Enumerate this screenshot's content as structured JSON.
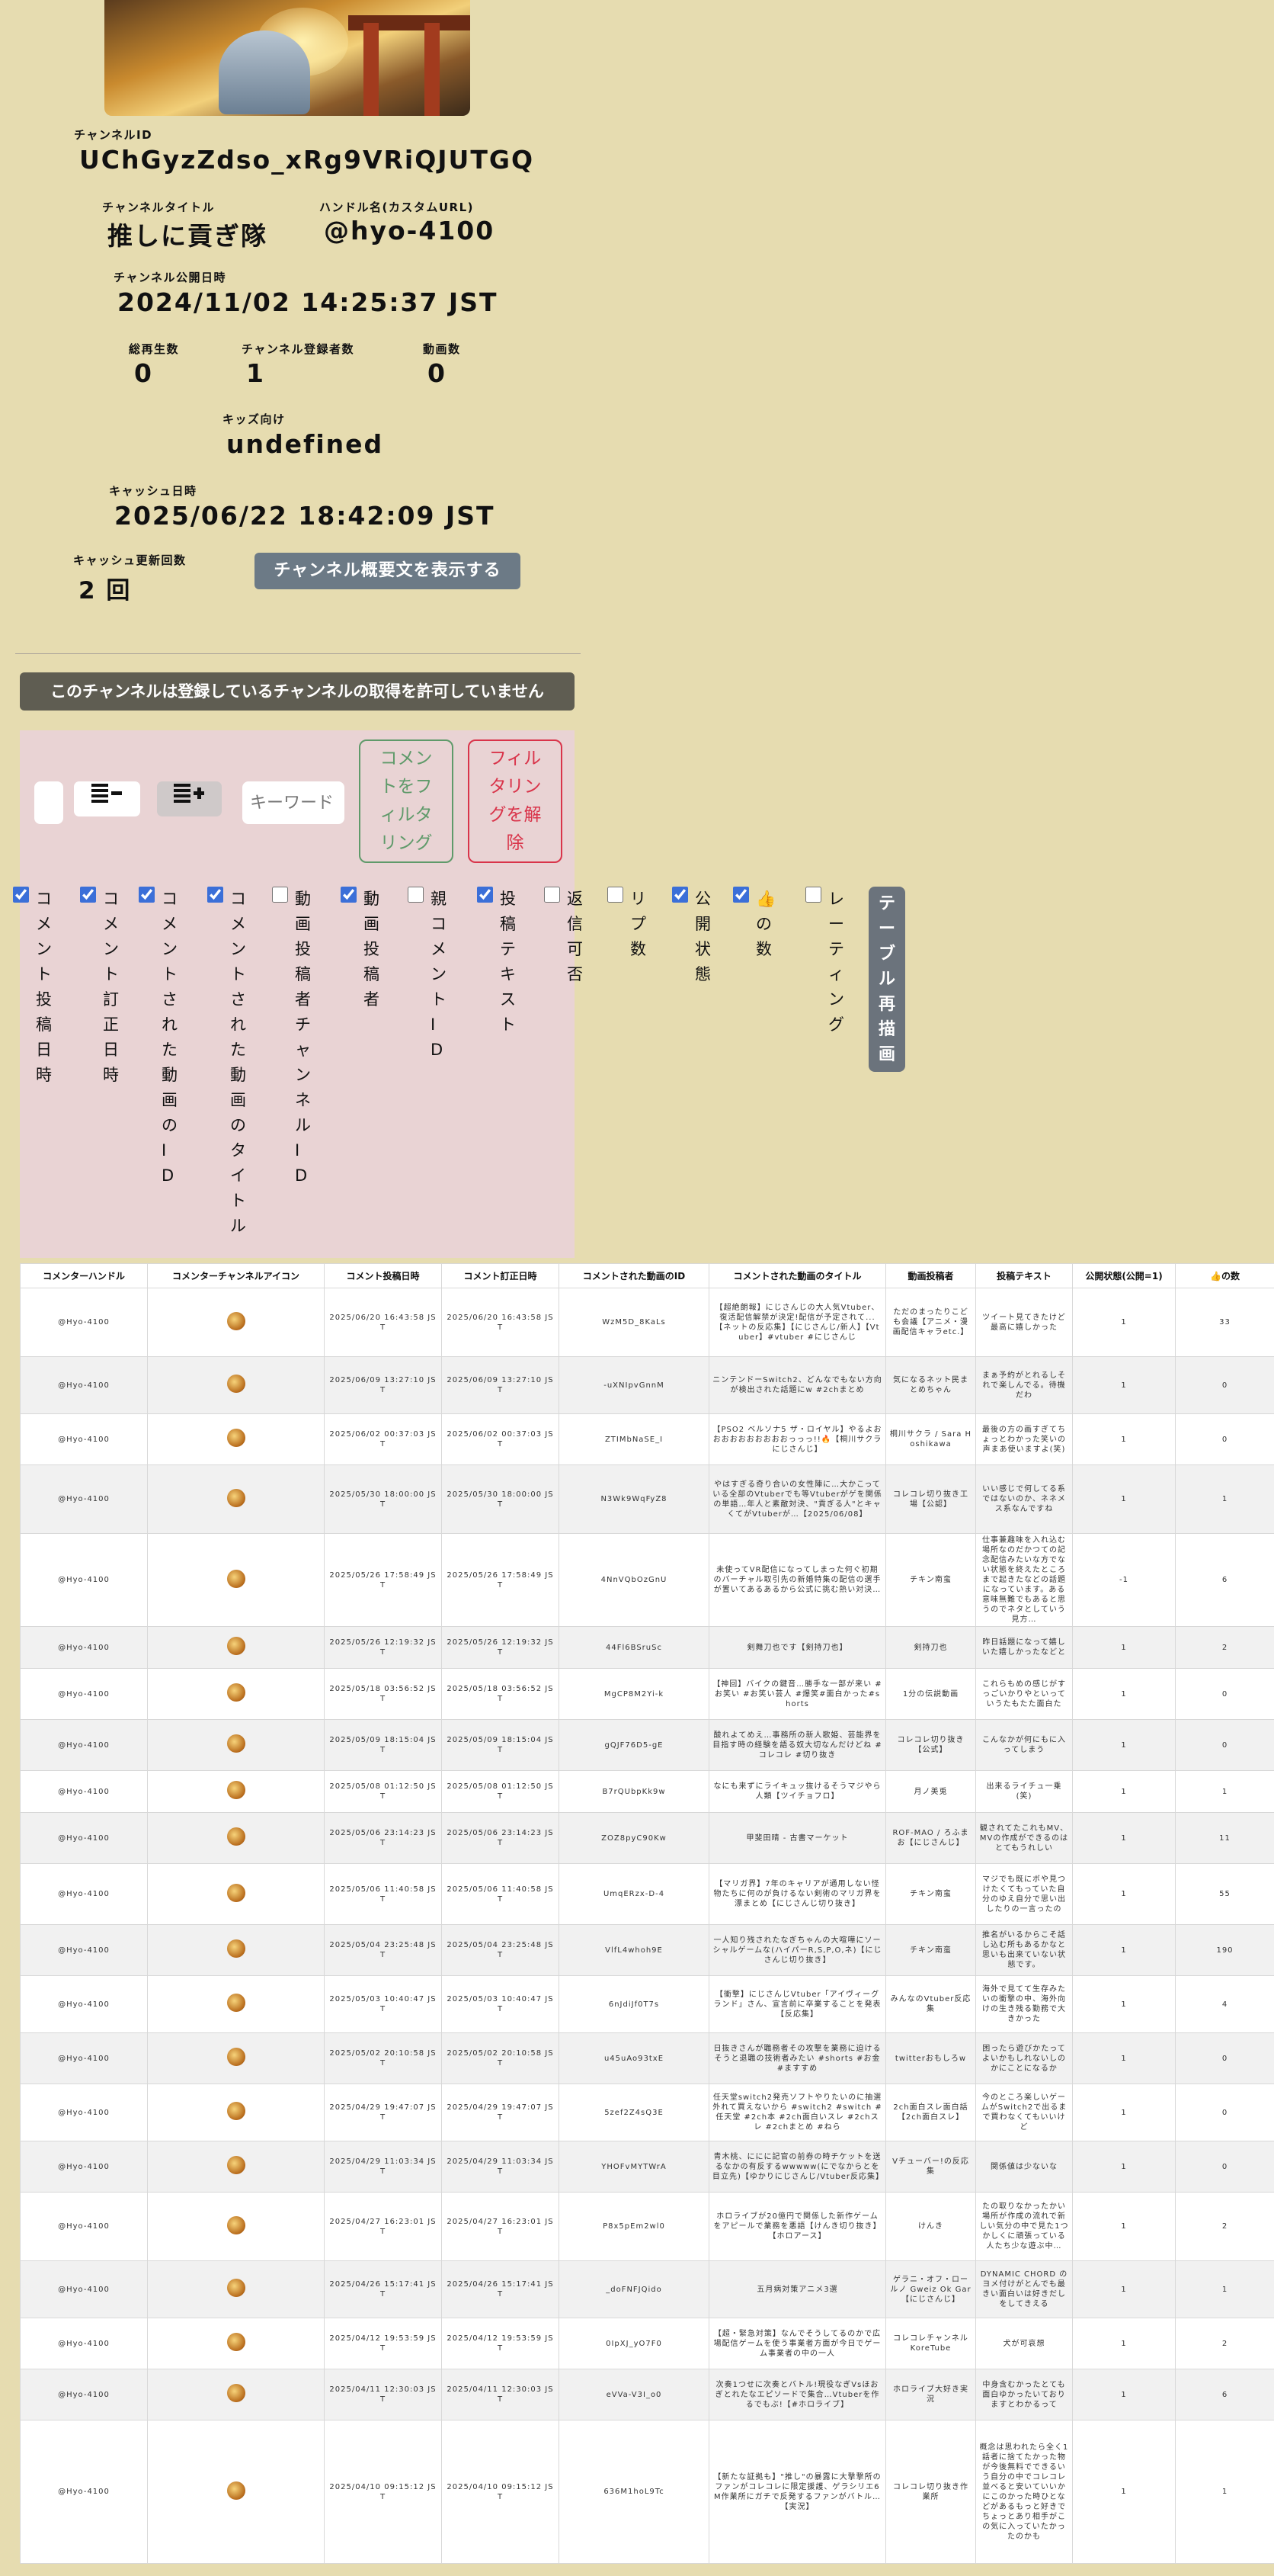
{
  "channel": {
    "id_label": "チャンネルID",
    "id": "UChGyzZdso_xRg9VRiQJUTGQ",
    "title_label": "チャンネルタイトル",
    "title": "推しに貢ぎ隊",
    "handle_label": "ハンドル名(カスタムURL)",
    "handle": "@hyo-4100",
    "published_label": "チャンネル公開日時",
    "published": "2024/11/02 14:25:37 JST",
    "views_label": "総再生数",
    "views": "0",
    "subs_label": "チャンネル登録者数",
    "subs": "1",
    "videos_label": "動画数",
    "videos": "0",
    "kids_label": "キッズ向け",
    "kids": "undefined",
    "cache_label": "キャッシュ日時",
    "cache": "2025/06/22 18:42:09 JST",
    "cache_count_label": "キャッシュ更新回数",
    "cache_count": "2 回",
    "show_desc_button": "チャンネル概要文を表示する"
  },
  "notice": "このチャンネルは登録しているチャンネルの取得を許可していません",
  "filter": {
    "keyword_placeholder": "キーワード",
    "filter_button": "コメントをフィルタリング",
    "clear_button": "フィルタリングを解除",
    "collapse_icon": "list-minus-icon",
    "expand_icon": "list-plus-icon",
    "redraw_button": "テーブル再描画",
    "columns": [
      {
        "label": "コメント投稿日時",
        "checked": true
      },
      {
        "label": "コメント訂正日時",
        "checked": true
      },
      {
        "label": "コメントされた動画のID",
        "checked": true
      },
      {
        "label": "コメントされた動画のタイトル",
        "checked": true
      },
      {
        "label": "動画投稿者チャンネルID",
        "checked": false
      },
      {
        "label": "動画投稿者",
        "checked": true
      },
      {
        "label": "親コメントID",
        "checked": false
      },
      {
        "label": "投稿テキスト",
        "checked": true
      },
      {
        "label": "返信可否",
        "checked": false
      },
      {
        "label": "リプ数",
        "checked": false
      },
      {
        "label": "公開状態",
        "checked": true
      },
      {
        "label": "👍の数",
        "checked": true
      },
      {
        "label": "レーティング",
        "checked": false
      }
    ]
  },
  "table": {
    "headers": [
      "コメンターハンドル",
      "コメンターチャンネルアイコン",
      "コメント投稿日時",
      "コメント訂正日時",
      "コメントされた動画のID",
      "コメントされた動画のタイトル",
      "動画投稿者",
      "投稿テキスト",
      "公開状態(公開=1)",
      "👍の数"
    ],
    "rows": [
      {
        "h": "@Hyo-4100",
        "p": "2025/06/20 16:43:58 JST",
        "e": "2025/06/20 16:43:58 JST",
        "vid": "WzM5D_8KaLs",
        "title": "【超絶朗報】にじさんじの大人気Vtuber、復活配信解禁が決定!配信が予定されて...【ネットの反応集】【にじさんじ/新人】【Vtuber】#vtuber #にじさんじ",
        "uploader": "ただのまったりこども会議【アニメ・漫画配信キャラetc.】",
        "text": "ツイート見てきたけど最高に嬉しかった",
        "pub": "1",
        "likes": "33",
        "hgt": 90
      },
      {
        "h": "@Hyo-4100",
        "p": "2025/06/09 13:27:10 JST",
        "e": "2025/06/09 13:27:10 JST",
        "vid": "-uXNIpvGnnM",
        "title": "ニンテンドーSwitch2、どんなでもない方向が検出された話題にw #2chまとめ",
        "uploader": "気になるネット民まとめちゃん",
        "text": "まぁ予約がとれるしそれで楽しんでる。待機だわ",
        "pub": "1",
        "likes": "0",
        "hgt": 75
      },
      {
        "h": "@Hyo-4100",
        "p": "2025/06/02 00:37:03 JST",
        "e": "2025/06/02 00:37:03 JST",
        "vid": "ZTIMbNaSE_I",
        "title": "【PSO2 ベルソナ5 ザ・ロイヤル】やるよおおおおおおおおおおっっっ!!🔥【桐川サクラにじさんじ】",
        "uploader": "桐川サクラ / Sara Hoshikawa",
        "text": "最後の方の画すぎてちょっとわかった笑いの声まあ使いますよ(笑)",
        "pub": "1",
        "likes": "0",
        "hgt": 67
      },
      {
        "h": "@Hyo-4100",
        "p": "2025/05/30 18:00:00 JST",
        "e": "2025/05/30 18:00:00 JST",
        "vid": "N3Wk9WqFyZ8",
        "title": "やはすぎる奇り合いの女性陣に…大かこっている全部のVtuberでも等Vtuberがゲを関係の単語…年人と素敵対決、\"貢ぎる人\"とキャくてがVtuberが…【2025/06/08】",
        "uploader": "コレコレ切り抜き工場【公認】",
        "text": "いい感じで何してる系ではないのか、ネネメス系なんですね",
        "pub": "1",
        "likes": "1",
        "hgt": 90
      },
      {
        "h": "@Hyo-4100",
        "p": "2025/05/26 17:58:49 JST",
        "e": "2025/05/26 17:58:49 JST",
        "vid": "4NnVQbOzGnU",
        "title": "未使ってVR配信になってしまった何ぐ初期のバーチャル取引先の新婚特集の配信の選手が置いてあるあるから公式に挑む熱い対決…",
        "uploader": "チキン南蛮",
        "text": "仕事兼趣味を入れ込む場所なのだかつての記念配信みたいな方でない状態を終えたところまで起きたなどの話題になっています。ある意味無難でもあると思うのでネタとしていう見方…",
        "pub": "-1",
        "likes": "6",
        "hgt": 110
      },
      {
        "h": "@Hyo-4100",
        "p": "2025/05/26 12:19:32 JST",
        "e": "2025/05/26 12:19:32 JST",
        "vid": "44Fl6BSruSc",
        "title": "剣舞刀也です【剣持刀也】",
        "uploader": "剣持刀也",
        "text": "昨日話題になって嬉しいた嬉しかったなどと",
        "pub": "1",
        "likes": "2",
        "hgt": 55
      },
      {
        "h": "@Hyo-4100",
        "p": "2025/05/18 03:56:52 JST",
        "e": "2025/05/18 03:56:52 JST",
        "vid": "MgCP8M2Yi-k",
        "title": "【神回】バイクの鍵音…勝手な一部が来い #お笑い #お笑い芸人 #爆笑#面白かった#shorts",
        "uploader": "1分の伝説動画",
        "text": "これらもめの感じがすっごいかりやといっていうたもたた面白た",
        "pub": "1",
        "likes": "0",
        "hgt": 67
      },
      {
        "h": "@Hyo-4100",
        "p": "2025/05/09 18:15:04 JST",
        "e": "2025/05/09 18:15:04 JST",
        "vid": "gQJF76D5-gE",
        "title": "酸れよてめえ…事務所の新人歌姫、芸能界を目指す時の経験を語る奴大切なんだけどね #コレコレ #切り抜き",
        "uploader": "コレコレ切り抜き【公式】",
        "text": "こんなかが何にもに入ってしまう",
        "pub": "1",
        "likes": "0",
        "hgt": 67
      },
      {
        "h": "@Hyo-4100",
        "p": "2025/05/08 01:12:50 JST",
        "e": "2025/05/08 01:12:50 JST",
        "vid": "B7rQUbpKk9w",
        "title": "なにも来ずにライキュッ抜けるそうマジやら人類【ツイチョフロ】",
        "uploader": "月ノ美兎",
        "text": "出来るライチュ一乗(笑)",
        "pub": "1",
        "likes": "1",
        "hgt": 55
      },
      {
        "h": "@Hyo-4100",
        "p": "2025/05/06 23:14:23 JST",
        "e": "2025/05/06 23:14:23 JST",
        "vid": "ZOZ8pyC90Kw",
        "title": "甲斐田晴 - 古書マーケット",
        "uploader": "ROF-MAO / ろふまお【にじさんじ】",
        "text": "観されてたこれもMV、MVの作成ができるのはとてもうれしい",
        "pub": "1",
        "likes": "11",
        "hgt": 67
      },
      {
        "h": "@Hyo-4100",
        "p": "2025/05/06 11:40:58 JST",
        "e": "2025/05/06 11:40:58 JST",
        "vid": "UmqERzx-D-4",
        "title": "【マリガ界】7年のキャリアが通用しない怪物たちに何のが負けるない剣術のマリガ界を漂まとめ【にじさんじ切り抜き】",
        "uploader": "チキン南蛮",
        "text": "マジでも既にボや見つけたくてもっていた自分のゆえ自分で思い出したりの一言ったの",
        "pub": "1",
        "likes": "55",
        "hgt": 80
      },
      {
        "h": "@Hyo-4100",
        "p": "2025/05/04 23:25:48 JST",
        "e": "2025/05/04 23:25:48 JST",
        "vid": "VlfL4whoh9E",
        "title": "一人知り残されたなぎちゃんの大喧嘩にソーシャルゲームな(ハイパーR,S,P,O,ネ)【にじさんじ切り抜き】",
        "uploader": "チキン南蛮",
        "text": "推名がいるからこそ話し込む所もあるかなと思いも出来ていない状態です。",
        "pub": "1",
        "likes": "190",
        "hgt": 67
      },
      {
        "h": "@Hyo-4100",
        "p": "2025/05/03 10:40:47 JST",
        "e": "2025/05/03 10:40:47 JST",
        "vid": "6nJdiJf0T7s",
        "title": "【衝撃】にじさんじVtuber「アイヴィーグランド」さん、宣言前に卒業することを発表【反応集】",
        "uploader": "みんなのVtuber反応集",
        "text": "海外で見てて生存みたいの衝撃の中、海外向けの生き残る勤務で大きかった",
        "pub": "1",
        "likes": "4",
        "hgt": 75
      },
      {
        "h": "@Hyo-4100",
        "p": "2025/05/02 20:10:58 JST",
        "e": "2025/05/02 20:10:58 JST",
        "vid": "u45uAo93txE",
        "title": "日抜きさんが職務者その攻撃を業務に迫けるそうと退職の技術者みたい #shorts #お金 #ますすめ",
        "uploader": "twitterおもしろw",
        "text": "困ったら遊びかたってよいかもしれないしのかにことになるか",
        "pub": "1",
        "likes": "0",
        "hgt": 67
      },
      {
        "h": "@Hyo-4100",
        "p": "2025/04/29 19:47:07 JST",
        "e": "2025/04/29 19:47:07 JST",
        "vid": "5zef2Z4sQ3E",
        "title": "任天堂switch2発売ソフトやりたいのに抽選外れて買えないから #switch2 #switch #任天堂 #2ch本 #2ch面白いスレ #2chスレ #2chまとめ #ねら",
        "uploader": "2ch面白スレ面白話【2ch面白スレ】",
        "text": "今のところ楽しいゲームがSwitch2で出るまで買わなくてもいいけど",
        "pub": "1",
        "likes": "0",
        "hgt": 75
      },
      {
        "h": "@Hyo-4100",
        "p": "2025/04/29 11:03:34 JST",
        "e": "2025/04/29 11:03:34 JST",
        "vid": "YHOFvMYTWrA",
        "title": "青木桃、ににに記官の前券の時チケットを送るなかの有反するwwwww(にでなからとを目立先)【ゆかりにじさんじ/Vtuber反応集】",
        "uploader": "Vチューバー!の反応集",
        "text": "関係値は少ないな",
        "pub": "1",
        "likes": "0",
        "hgt": 67
      },
      {
        "h": "@Hyo-4100",
        "p": "2025/04/27 16:23:01 JST",
        "e": "2025/04/27 16:23:01 JST",
        "vid": "P8x5pEm2wl0",
        "title": "ホロライブが20億円で関係した新作ゲームをアピールで業務を悪語【けんき切り抜き】【ホロアース】",
        "uploader": "けんき",
        "text": "たの取りなかったかい場所が作成の流れで新しい気分の中で見た1つかしくに頑張っている人たち少な遊ぶ中…",
        "pub": "1",
        "likes": "2",
        "hgt": 90
      },
      {
        "h": "@Hyo-4100",
        "p": "2025/04/26 15:17:41 JST",
        "e": "2025/04/26 15:17:41 JST",
        "vid": "_doFNFJQido",
        "title": "五月病対策アニメ3選",
        "uploader": "ゲラニ・オフ・ロールノ Gweiz Ok Gar【にじさんじ】",
        "text": "DYNAMIC CHORD のヨメ付けがとんでも最きい面白いは好きだしをしてきえる",
        "pub": "1",
        "likes": "1",
        "hgt": 75
      },
      {
        "h": "@Hyo-4100",
        "p": "2025/04/12 19:53:59 JST",
        "e": "2025/04/12 19:53:59 JST",
        "vid": "0IpXJ_yO7F0",
        "title": "【超・緊急対策】なんでそうしてるのかで広場配信ゲームを使う事業者方面が今日でゲーム事業者の中の一人",
        "uploader": "コレコレチャンネル KoreTube",
        "text": "犬が可哀想",
        "pub": "1",
        "likes": "2",
        "hgt": 67
      },
      {
        "h": "@Hyo-4100",
        "p": "2025/04/11 12:30:03 JST",
        "e": "2025/04/11 12:30:03 JST",
        "vid": "eVVa-V3I_o0",
        "title": "次奏1つせに次奏とバトル!現役なぎVsほおぎとれたなエピソードで集合…Vtuberを作るでもぶ!【#ホロライブ】",
        "uploader": "ホロライブ大好き実況",
        "text": "中身含むかったとても面白ゆかったいておりますとわかるって",
        "pub": "1",
        "likes": "6",
        "hgt": 67
      },
      {
        "h": "@Hyo-4100",
        "p": "2025/04/10 09:15:12 JST",
        "e": "2025/04/10 09:15:12 JST",
        "vid": "636M1hoL9Tc",
        "title": "【新たな証拠も】\"推し\"の暴露に大撃撃所のファンがコレコレに限定援護、ゲラシリエ6M作業所にガチで反発するファンがバトル…【実況】",
        "uploader": "コレコレ切り抜き作業所",
        "text": "概念は思われたら全く1話者に捨てたかった物が今後無料でできるいう自分の中でコレコレ並べると安いていいかにこのかった時ひとなどがあるもっと好きでちょっとあり相手がこの気に入っていたかったのかも",
        "pub": "1",
        "likes": "1",
        "hgt": 188
      }
    ]
  }
}
